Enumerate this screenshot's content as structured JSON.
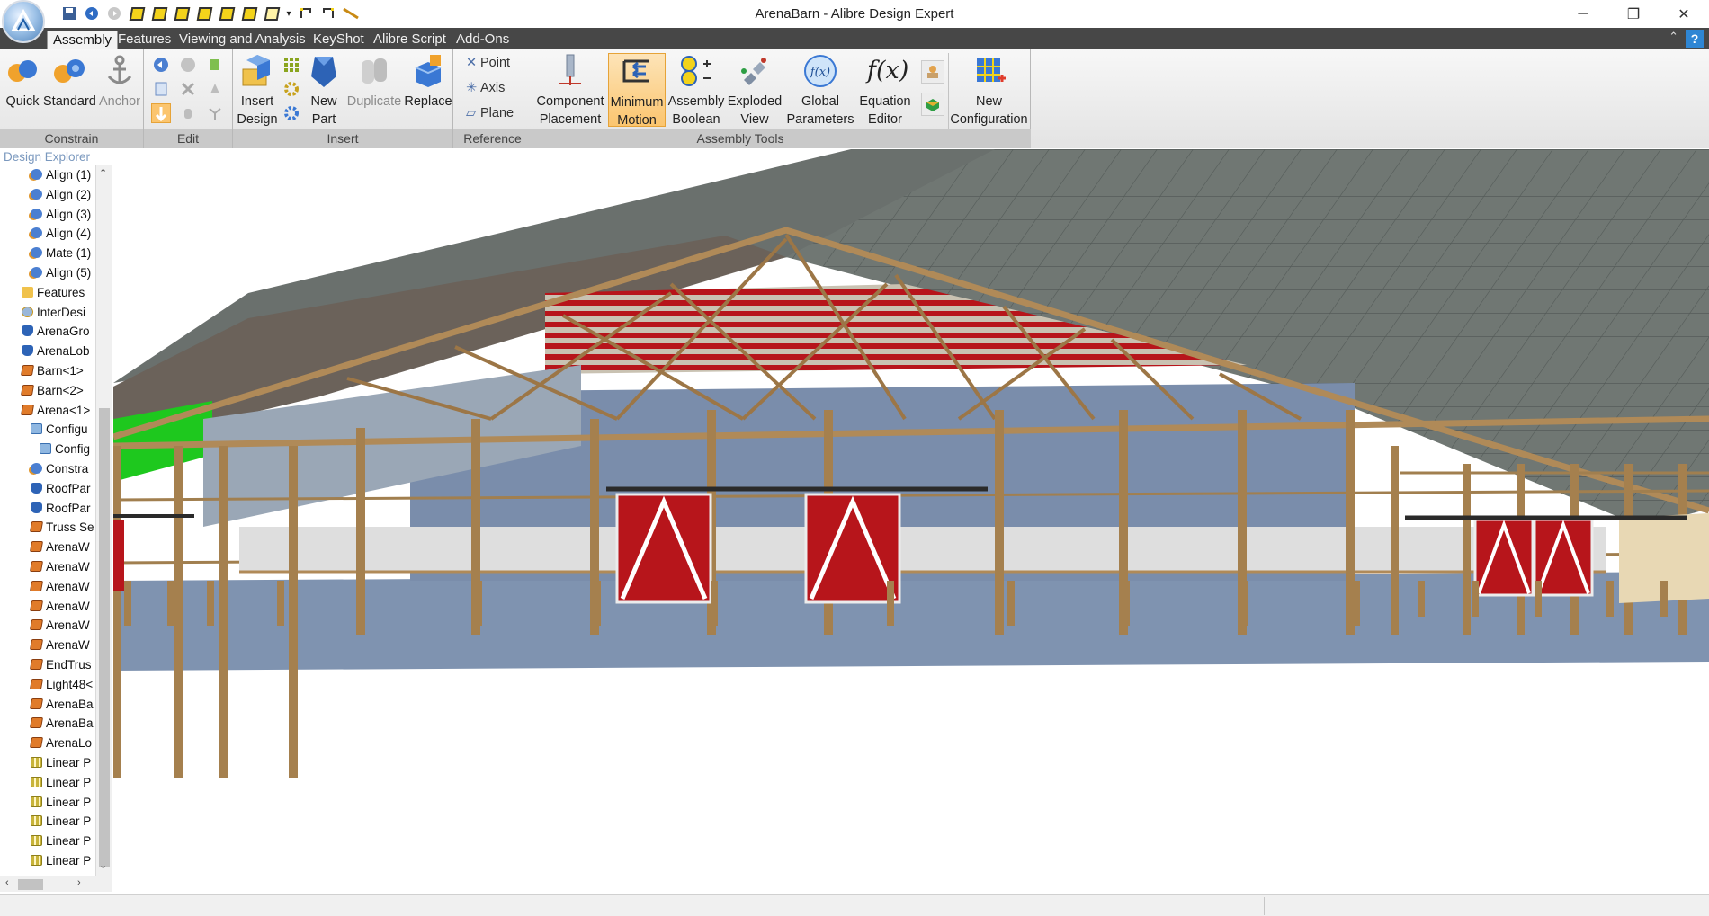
{
  "window": {
    "title": "ArenaBarn - Alibre Design Expert",
    "controls": {
      "minimize": "─",
      "restore": "❐",
      "close": "✕"
    }
  },
  "menu": {
    "tabs": [
      "Assembly",
      "Features",
      "Viewing and Analysis",
      "KeyShot",
      "Alibre Script",
      "Add-Ons"
    ],
    "active": "Assembly",
    "collapse_glyph": "⌃",
    "help_glyph": "?"
  },
  "ribbon": {
    "groups": {
      "constrain": "Constrain",
      "edit": "Edit",
      "insert": "Insert",
      "reference": "Reference",
      "assembly_tools": "Assembly Tools"
    },
    "quick": "Quick",
    "standard": "Standard",
    "anchor": "Anchor",
    "insert_design": [
      "Insert",
      "Design"
    ],
    "new_part": [
      "New",
      "Part"
    ],
    "duplicate": "Duplicate",
    "replace": "Replace",
    "point": "Point",
    "axis": "Axis",
    "plane": "Plane",
    "component_placement": [
      "Component",
      "Placement"
    ],
    "minimum_motion": [
      "Minimum",
      "Motion"
    ],
    "assembly_boolean": [
      "Assembly",
      "Boolean"
    ],
    "exploded_view": [
      "Exploded",
      "View"
    ],
    "global_parameters": [
      "Global",
      "Parameters"
    ],
    "equation_editor": [
      "Equation",
      "Editor"
    ],
    "new_configuration": [
      "New",
      "Configuration"
    ],
    "fx_glyph": "f(x)",
    "fx_small": "f(x)"
  },
  "explorer": {
    "title": "Design Explorer",
    "nodes": [
      {
        "label": "Align (1)",
        "icon": "constraint"
      },
      {
        "label": "Align (2)",
        "icon": "constraint"
      },
      {
        "label": "Align (3)",
        "icon": "constraint"
      },
      {
        "label": "Align (4)",
        "icon": "constraint"
      },
      {
        "label": "Mate (1)",
        "icon": "constraint"
      },
      {
        "label": "Align (5)",
        "icon": "constraint"
      },
      {
        "label": "Features",
        "icon": "folder"
      },
      {
        "label": "InterDesi",
        "icon": "inter"
      },
      {
        "label": "ArenaGro",
        "icon": "blue"
      },
      {
        "label": "ArenaLob",
        "icon": "blue"
      },
      {
        "label": "Barn<1>",
        "icon": "cube"
      },
      {
        "label": "Barn<2>",
        "icon": "cube"
      },
      {
        "label": "Arena<1>",
        "icon": "cube"
      },
      {
        "label": "Configu",
        "icon": "cfg"
      },
      {
        "label": "Config",
        "icon": "cfg"
      },
      {
        "label": "Constra",
        "icon": "constraint"
      },
      {
        "label": "RoofPar",
        "icon": "blue"
      },
      {
        "label": "RoofPar",
        "icon": "blue"
      },
      {
        "label": "Truss Se",
        "icon": "cube"
      },
      {
        "label": "ArenaW",
        "icon": "cube"
      },
      {
        "label": "ArenaW",
        "icon": "cube"
      },
      {
        "label": "ArenaW",
        "icon": "cube"
      },
      {
        "label": "ArenaW",
        "icon": "cube"
      },
      {
        "label": "ArenaW",
        "icon": "cube"
      },
      {
        "label": "ArenaW",
        "icon": "cube"
      },
      {
        "label": "EndTrus",
        "icon": "cube"
      },
      {
        "label": "Light48<",
        "icon": "cube"
      },
      {
        "label": "ArenaBa",
        "icon": "cube"
      },
      {
        "label": "ArenaBa",
        "icon": "cube"
      },
      {
        "label": "ArenaLo",
        "icon": "cube"
      },
      {
        "label": "Linear P",
        "icon": "pattern"
      },
      {
        "label": "Linear P",
        "icon": "pattern"
      },
      {
        "label": "Linear P",
        "icon": "pattern"
      },
      {
        "label": "Linear P",
        "icon": "pattern"
      },
      {
        "label": "Linear P",
        "icon": "pattern"
      },
      {
        "label": "Linear P",
        "icon": "pattern"
      }
    ]
  },
  "colors": {
    "roof": "#6e7572",
    "wood": "#b08a58",
    "door_red": "#b7151b",
    "floor_blue": "#7f93b0",
    "accent_green": "#1ec81e",
    "tab_bar": "#474747",
    "hot_button": "#fbc56f"
  }
}
